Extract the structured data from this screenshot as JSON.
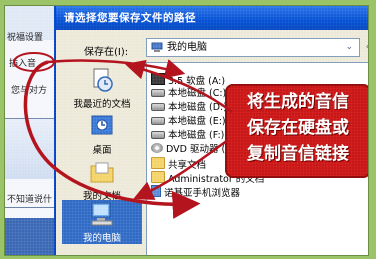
{
  "background_app": {
    "items": [
      "祝福设置",
      "插入音",
      "您与对方",
      "不知道说什"
    ]
  },
  "dialog": {
    "title": "请选择您要保存文件的路径",
    "save_in_label": "保存在(I):",
    "save_in_value": "我的电脑"
  },
  "places": [
    {
      "label": "我最近的文档",
      "icon": "recent-docs-icon"
    },
    {
      "label": "桌面",
      "icon": "desktop-icon"
    },
    {
      "label": "我的文档",
      "icon": "my-documents-icon"
    },
    {
      "label": "我的电脑",
      "icon": "my-computer-icon"
    }
  ],
  "files": [
    {
      "label": "3.5 软盘 (A:)",
      "icon": "floppy"
    },
    {
      "label": "本地磁盘 (C:)",
      "icon": "drive"
    },
    {
      "label": "本地磁盘 (D:)",
      "icon": "drive"
    },
    {
      "label": "本地磁盘 (E:)",
      "icon": "drive"
    },
    {
      "label": "本地磁盘 (F:)",
      "icon": "drive"
    },
    {
      "label": "DVD 驱动器 (G:)",
      "icon": "dvd"
    },
    {
      "label": "共享文档",
      "icon": "folder"
    },
    {
      "label": "Administrator 的文档",
      "icon": "folder"
    },
    {
      "label": "诺基亚手机浏览器",
      "icon": "phone"
    }
  ],
  "callout": {
    "lines": [
      "将生成的音信",
      "保存在硬盘或",
      "复制音信链接"
    ]
  },
  "colors": {
    "titlebar": "#0a4fd4",
    "callout": "#c91616",
    "arrow": "#b4141e",
    "background": "#9bc468"
  }
}
